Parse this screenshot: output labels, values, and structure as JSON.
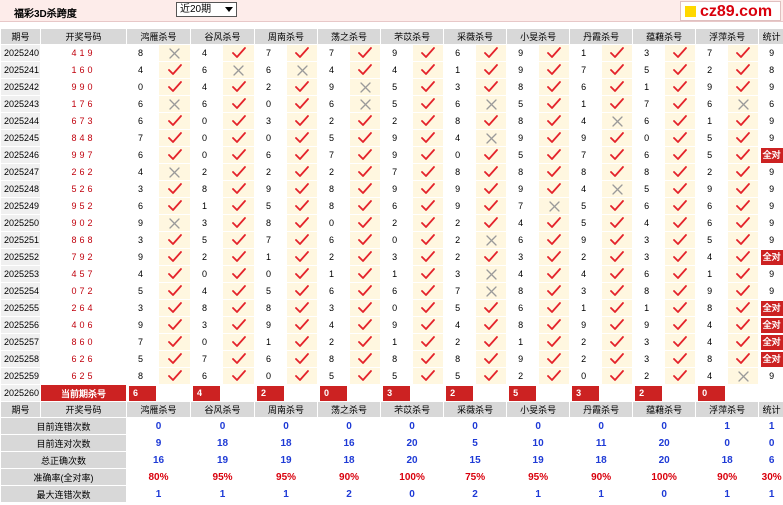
{
  "title": "福彩3D杀跨度",
  "period_select": {
    "value": "近20期"
  },
  "logo": {
    "text": "cz89.com"
  },
  "header": {
    "period": "期号",
    "draw": "开奖号码",
    "experts": [
      "鸿雁杀号",
      "谷风杀号",
      "周南杀号",
      "荡之杀号",
      "芣苡杀号",
      "采薇杀号",
      "小旻杀号",
      "丹霞杀号",
      "蕴藉杀号",
      "浮萍杀号"
    ],
    "stat": "统计"
  },
  "all_correct_label": "全对",
  "rows": [
    {
      "period": "2025240",
      "draw": "419",
      "picks": [
        [
          8,
          0
        ],
        [
          4,
          1
        ],
        [
          7,
          1
        ],
        [
          7,
          1
        ],
        [
          9,
          1
        ],
        [
          6,
          1
        ],
        [
          9,
          1
        ],
        [
          1,
          1
        ],
        [
          3,
          1
        ],
        [
          7,
          1
        ]
      ],
      "stat": "9"
    },
    {
      "period": "2025241",
      "draw": "160",
      "picks": [
        [
          4,
          1
        ],
        [
          6,
          0
        ],
        [
          6,
          0
        ],
        [
          4,
          1
        ],
        [
          4,
          1
        ],
        [
          1,
          1
        ],
        [
          9,
          1
        ],
        [
          7,
          1
        ],
        [
          5,
          1
        ],
        [
          2,
          1
        ]
      ],
      "stat": "8"
    },
    {
      "period": "2025242",
      "draw": "990",
      "picks": [
        [
          0,
          1
        ],
        [
          4,
          1
        ],
        [
          2,
          1
        ],
        [
          9,
          0
        ],
        [
          5,
          1
        ],
        [
          3,
          1
        ],
        [
          8,
          1
        ],
        [
          6,
          1
        ],
        [
          1,
          1
        ],
        [
          9,
          1
        ]
      ],
      "stat": "9"
    },
    {
      "period": "2025243",
      "draw": "176",
      "picks": [
        [
          6,
          0
        ],
        [
          6,
          1
        ],
        [
          0,
          1
        ],
        [
          6,
          0
        ],
        [
          5,
          1
        ],
        [
          6,
          0
        ],
        [
          5,
          1
        ],
        [
          1,
          1
        ],
        [
          7,
          1
        ],
        [
          6,
          0
        ]
      ],
      "stat": "6"
    },
    {
      "period": "2025244",
      "draw": "673",
      "picks": [
        [
          6,
          1
        ],
        [
          0,
          1
        ],
        [
          3,
          1
        ],
        [
          2,
          1
        ],
        [
          2,
          1
        ],
        [
          8,
          1
        ],
        [
          8,
          1
        ],
        [
          4,
          0
        ],
        [
          6,
          1
        ],
        [
          1,
          1
        ]
      ],
      "stat": "9"
    },
    {
      "period": "2025245",
      "draw": "848",
      "picks": [
        [
          7,
          1
        ],
        [
          0,
          1
        ],
        [
          0,
          1
        ],
        [
          5,
          1
        ],
        [
          9,
          1
        ],
        [
          4,
          0
        ],
        [
          9,
          1
        ],
        [
          9,
          1
        ],
        [
          0,
          1
        ],
        [
          5,
          1
        ]
      ],
      "stat": "9"
    },
    {
      "period": "2025246",
      "draw": "997",
      "picks": [
        [
          6,
          1
        ],
        [
          0,
          1
        ],
        [
          6,
          1
        ],
        [
          7,
          1
        ],
        [
          9,
          1
        ],
        [
          0,
          1
        ],
        [
          5,
          1
        ],
        [
          7,
          1
        ],
        [
          6,
          1
        ],
        [
          5,
          1
        ]
      ],
      "stat": "全对"
    },
    {
      "period": "2025247",
      "draw": "262",
      "picks": [
        [
          4,
          0
        ],
        [
          2,
          1
        ],
        [
          2,
          1
        ],
        [
          2,
          1
        ],
        [
          7,
          1
        ],
        [
          8,
          1
        ],
        [
          8,
          1
        ],
        [
          8,
          1
        ],
        [
          8,
          1
        ],
        [
          2,
          1
        ]
      ],
      "stat": "9"
    },
    {
      "period": "2025248",
      "draw": "526",
      "picks": [
        [
          3,
          1
        ],
        [
          8,
          1
        ],
        [
          9,
          1
        ],
        [
          8,
          1
        ],
        [
          9,
          1
        ],
        [
          9,
          1
        ],
        [
          9,
          1
        ],
        [
          4,
          0
        ],
        [
          5,
          1
        ],
        [
          9,
          1
        ]
      ],
      "stat": "9"
    },
    {
      "period": "2025249",
      "draw": "952",
      "picks": [
        [
          6,
          1
        ],
        [
          1,
          1
        ],
        [
          5,
          1
        ],
        [
          8,
          1
        ],
        [
          6,
          1
        ],
        [
          9,
          1
        ],
        [
          7,
          0
        ],
        [
          5,
          1
        ],
        [
          6,
          1
        ],
        [
          6,
          1
        ]
      ],
      "stat": "9"
    },
    {
      "period": "2025250",
      "draw": "902",
      "picks": [
        [
          9,
          0
        ],
        [
          3,
          1
        ],
        [
          8,
          1
        ],
        [
          0,
          1
        ],
        [
          2,
          1
        ],
        [
          2,
          1
        ],
        [
          4,
          1
        ],
        [
          5,
          1
        ],
        [
          4,
          1
        ],
        [
          6,
          1
        ]
      ],
      "stat": "9"
    },
    {
      "period": "2025251",
      "draw": "868",
      "picks": [
        [
          3,
          1
        ],
        [
          5,
          1
        ],
        [
          7,
          1
        ],
        [
          6,
          1
        ],
        [
          0,
          1
        ],
        [
          2,
          0
        ],
        [
          6,
          1
        ],
        [
          9,
          1
        ],
        [
          3,
          1
        ],
        [
          5,
          1
        ]
      ],
      "stat": "9"
    },
    {
      "period": "2025252",
      "draw": "792",
      "picks": [
        [
          9,
          1
        ],
        [
          2,
          1
        ],
        [
          1,
          1
        ],
        [
          2,
          1
        ],
        [
          3,
          1
        ],
        [
          2,
          1
        ],
        [
          3,
          1
        ],
        [
          2,
          1
        ],
        [
          3,
          1
        ],
        [
          4,
          1
        ]
      ],
      "stat": "全对"
    },
    {
      "period": "2025253",
      "draw": "457",
      "picks": [
        [
          4,
          1
        ],
        [
          0,
          1
        ],
        [
          0,
          1
        ],
        [
          1,
          1
        ],
        [
          1,
          1
        ],
        [
          3,
          0
        ],
        [
          4,
          1
        ],
        [
          4,
          1
        ],
        [
          6,
          1
        ],
        [
          1,
          1
        ]
      ],
      "stat": "9"
    },
    {
      "period": "2025254",
      "draw": "072",
      "picks": [
        [
          5,
          1
        ],
        [
          4,
          1
        ],
        [
          5,
          1
        ],
        [
          6,
          1
        ],
        [
          6,
          1
        ],
        [
          7,
          0
        ],
        [
          8,
          1
        ],
        [
          3,
          1
        ],
        [
          8,
          1
        ],
        [
          9,
          1
        ]
      ],
      "stat": "9"
    },
    {
      "period": "2025255",
      "draw": "264",
      "picks": [
        [
          3,
          1
        ],
        [
          8,
          1
        ],
        [
          8,
          1
        ],
        [
          3,
          1
        ],
        [
          0,
          1
        ],
        [
          5,
          1
        ],
        [
          6,
          1
        ],
        [
          1,
          1
        ],
        [
          1,
          1
        ],
        [
          8,
          1
        ]
      ],
      "stat": "全对"
    },
    {
      "period": "2025256",
      "draw": "406",
      "picks": [
        [
          9,
          1
        ],
        [
          3,
          1
        ],
        [
          9,
          1
        ],
        [
          4,
          1
        ],
        [
          9,
          1
        ],
        [
          4,
          1
        ],
        [
          8,
          1
        ],
        [
          9,
          1
        ],
        [
          9,
          1
        ],
        [
          4,
          1
        ]
      ],
      "stat": "全对"
    },
    {
      "period": "2025257",
      "draw": "860",
      "picks": [
        [
          7,
          1
        ],
        [
          0,
          1
        ],
        [
          1,
          1
        ],
        [
          2,
          1
        ],
        [
          1,
          1
        ],
        [
          2,
          1
        ],
        [
          1,
          1
        ],
        [
          2,
          1
        ],
        [
          3,
          1
        ],
        [
          4,
          1
        ]
      ],
      "stat": "全对"
    },
    {
      "period": "2025258",
      "draw": "626",
      "picks": [
        [
          5,
          1
        ],
        [
          7,
          1
        ],
        [
          6,
          1
        ],
        [
          8,
          1
        ],
        [
          8,
          1
        ],
        [
          8,
          1
        ],
        [
          9,
          1
        ],
        [
          2,
          1
        ],
        [
          3,
          1
        ],
        [
          8,
          1
        ]
      ],
      "stat": "全对"
    },
    {
      "period": "2025259",
      "draw": "625",
      "picks": [
        [
          8,
          1
        ],
        [
          6,
          1
        ],
        [
          0,
          1
        ],
        [
          5,
          1
        ],
        [
          5,
          1
        ],
        [
          5,
          1
        ],
        [
          2,
          1
        ],
        [
          0,
          1
        ],
        [
          2,
          1
        ],
        [
          4,
          0
        ]
      ],
      "stat": "9"
    }
  ],
  "current": {
    "period": "2025260",
    "label": "当前期杀号",
    "picks": [
      "6",
      "4",
      "2",
      "0",
      "3",
      "2",
      "5",
      "3",
      "2",
      "0"
    ]
  },
  "stats": [
    {
      "label": "目前连错次数",
      "values": [
        "0",
        "0",
        "0",
        "0",
        "0",
        "0",
        "0",
        "0",
        "0",
        "1",
        "1"
      ],
      "red": false
    },
    {
      "label": "目前连对次数",
      "values": [
        "9",
        "18",
        "18",
        "16",
        "20",
        "5",
        "10",
        "11",
        "20",
        "0",
        "0"
      ],
      "red": false
    },
    {
      "label": "总正确次数",
      "values": [
        "16",
        "19",
        "19",
        "18",
        "20",
        "15",
        "19",
        "18",
        "20",
        "18",
        "6"
      ],
      "red": false
    },
    {
      "label": "准确率(全对率)",
      "values": [
        "80%",
        "95%",
        "95%",
        "90%",
        "100%",
        "75%",
        "95%",
        "90%",
        "100%",
        "90%",
        "30%"
      ],
      "red": true
    },
    {
      "label": "最大连错次数",
      "values": [
        "1",
        "1",
        "1",
        "2",
        "0",
        "2",
        "1",
        "1",
        "0",
        "1",
        "1"
      ],
      "red": false
    }
  ]
}
